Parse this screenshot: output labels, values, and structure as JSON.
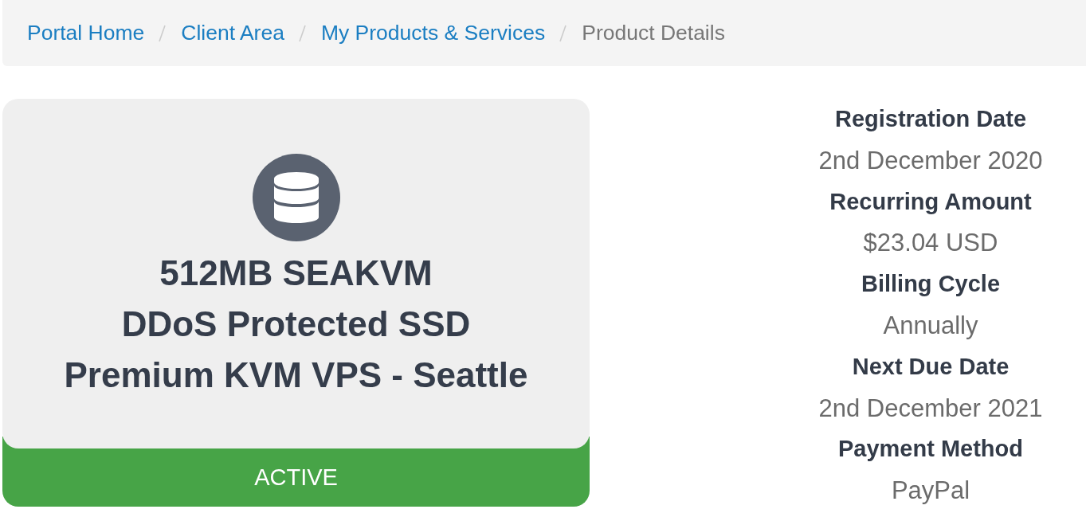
{
  "breadcrumb": [
    {
      "label": "Portal Home",
      "kind": "link"
    },
    {
      "label": "Client Area",
      "kind": "link"
    },
    {
      "label": "My Products & Services",
      "kind": "link"
    },
    {
      "label": "Product Details",
      "kind": "current"
    }
  ],
  "product": {
    "title_lines": [
      "512MB SEAKVM",
      "DDoS Protected SSD",
      "Premium KVM VPS - Seattle"
    ],
    "status": "ACTIVE"
  },
  "details": [
    {
      "label": "Registration Date",
      "value": "2nd December 2020"
    },
    {
      "label": "Recurring Amount",
      "value": "$23.04 USD"
    },
    {
      "label": "Billing Cycle",
      "value": "Annually"
    },
    {
      "label": "Next Due Date",
      "value": "2nd December 2021"
    },
    {
      "label": "Payment Method",
      "value": "PayPal"
    }
  ]
}
